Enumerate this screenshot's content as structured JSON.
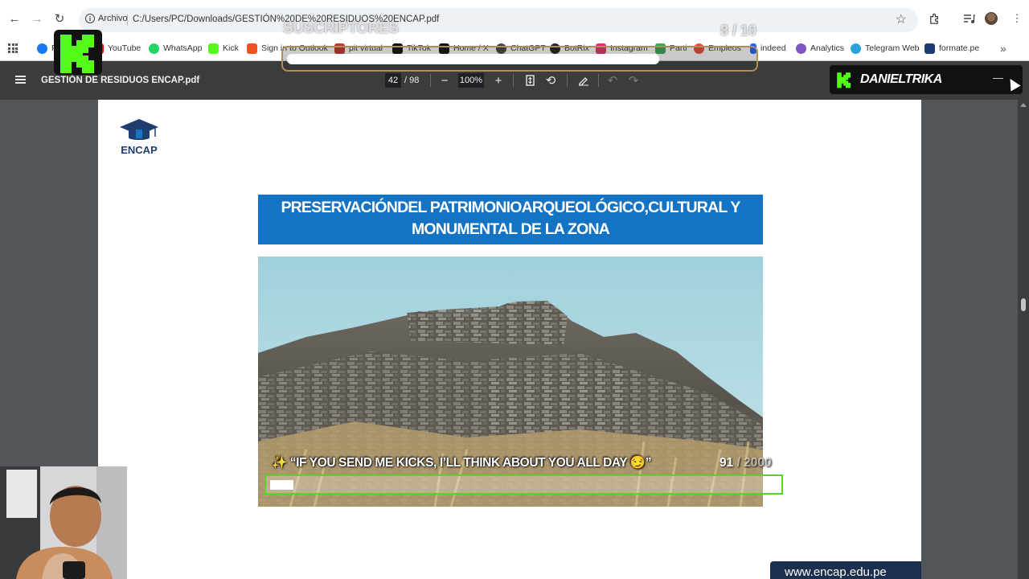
{
  "browser": {
    "site_info_label": "Archivo",
    "url": "C:/Users/PC/Downloads/GESTIÓN%20DE%20RESIDUOS%20ENCAP.pdf"
  },
  "bookmarks": [
    {
      "label": "F",
      "icon": "facebook-icon",
      "color": "#1877f2"
    },
    {
      "label": "YouTube",
      "icon": "youtube-icon",
      "color": "#ff0000"
    },
    {
      "label": "WhatsApp",
      "icon": "whatsapp-icon",
      "color": "#25d366"
    },
    {
      "label": "Kick",
      "icon": "kick-icon",
      "color": "#53fc18"
    },
    {
      "label": "Sign in to Outlook",
      "icon": "microsoft-icon",
      "color": "#f25022"
    },
    {
      "label": "pit virtual",
      "icon": "pit-icon",
      "color": "#c0392b"
    },
    {
      "label": "TikTok",
      "icon": "tiktok-icon",
      "color": "#111111"
    },
    {
      "label": "Home / X",
      "icon": "x-icon",
      "color": "#111111"
    },
    {
      "label": "ChatGPT",
      "icon": "chatgpt-icon",
      "color": "#444444"
    },
    {
      "label": "BotRix",
      "icon": "botrix-icon",
      "color": "#222222"
    },
    {
      "label": "Instagram",
      "icon": "instagram-icon",
      "color": "#e1306c"
    },
    {
      "label": "Parti",
      "icon": "parti-icon",
      "color": "#3aa757"
    },
    {
      "label": "Empleos",
      "icon": "empleos-icon",
      "color": "#e74c3c"
    },
    {
      "label": "indeed",
      "icon": "indeed-icon",
      "color": "#2164f3"
    },
    {
      "label": "Analytics",
      "icon": "analytics-icon",
      "color": "#7e57c2"
    },
    {
      "label": "Telegram Web",
      "icon": "telegram-icon",
      "color": "#2aa1da"
    },
    {
      "label": "formate.pe",
      "icon": "formate-icon",
      "color": "#1c3b70"
    }
  ],
  "pdf": {
    "filename": "GESTIÓN DE RESIDUOS ENCAP.pdf",
    "page_current": "42",
    "page_total": "/ 98",
    "zoom": "100%"
  },
  "page": {
    "logo_text": "ENCAP",
    "banner_line1": "PRESERVACIÓNDEL PATRIMONIOARQUEOLÓGICO,CULTURAL Y",
    "banner_line2": "MONUMENTAL DE LA  ZONA",
    "footer_url": "www.encap.edu.pe"
  },
  "overlay": {
    "subs_label": "SUSCRIPTORES",
    "subs_current": "8",
    "subs_total": "/ 10",
    "subs_progress": 0.8,
    "streamer": "DANIELTRIKA",
    "badge_extra": "—",
    "tts_message": "✨ “IF YOU SEND ME KICKS, I’LL THINK ABOUT YOU ALL DAY 😏”",
    "tts_count": "91",
    "tts_total": "/ 2000",
    "tts_progress": 0.0455,
    "kick_green": "#53fc18"
  }
}
